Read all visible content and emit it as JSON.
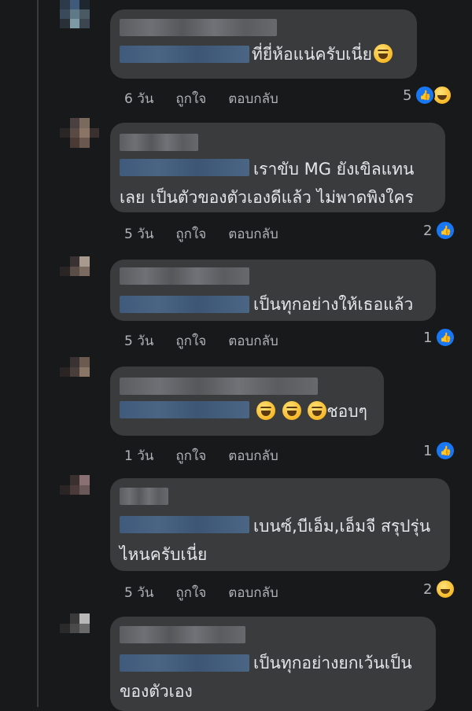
{
  "comments": [
    {
      "text_lines": [
        "ที่ยี่ห้อแน่ครับเนี่ย"
      ],
      "time": "6 วัน",
      "like_label": "ถูกใจ",
      "reply_label": "ตอบกลับ",
      "reaction_count": "5",
      "reactions": [
        "like-icon",
        "haha-icon"
      ]
    },
    {
      "text_lines": [
        "เราขับ MG ยังเขิลแทน",
        "เลย เป็นตัวของตัวเองดีแล้ว ไม่พาดพิงใคร"
      ],
      "time": "5 วัน",
      "like_label": "ถูกใจ",
      "reply_label": "ตอบกลับ",
      "reaction_count": "2",
      "reactions": [
        "like-icon"
      ]
    },
    {
      "text_lines": [
        "เป็นทุกอย่างให้เธอแล้ว"
      ],
      "time": "5 วัน",
      "like_label": "ถูกใจ",
      "reply_label": "ตอบกลับ",
      "reaction_count": "1",
      "reactions": [
        "like-icon"
      ]
    },
    {
      "text_lines": [
        "ชอบๆ"
      ],
      "time": "1 วัน",
      "like_label": "ถูกใจ",
      "reply_label": "ตอบกลับ",
      "reaction_count": "1",
      "reactions": [
        "like-icon"
      ]
    },
    {
      "text_lines": [
        "เบนซ์,บีเอ็ม,เอ็มจี สรุปรุ่น",
        "ไหนครับเนี่ย"
      ],
      "time": "5 วัน",
      "like_label": "ถูกใจ",
      "reply_label": "ตอบกลับ",
      "reaction_count": "2",
      "reactions": [
        "haha-icon"
      ]
    },
    {
      "text_lines": [
        "เป็นทุกอย่างยกเว้นเป็น",
        "ของตัวเอง"
      ]
    }
  ],
  "colors": {
    "background": "#18191a",
    "bubble": "#3a3b3c",
    "text": "#e4e6eb",
    "meta": "#b0b3b8",
    "like": "#1877f2"
  }
}
